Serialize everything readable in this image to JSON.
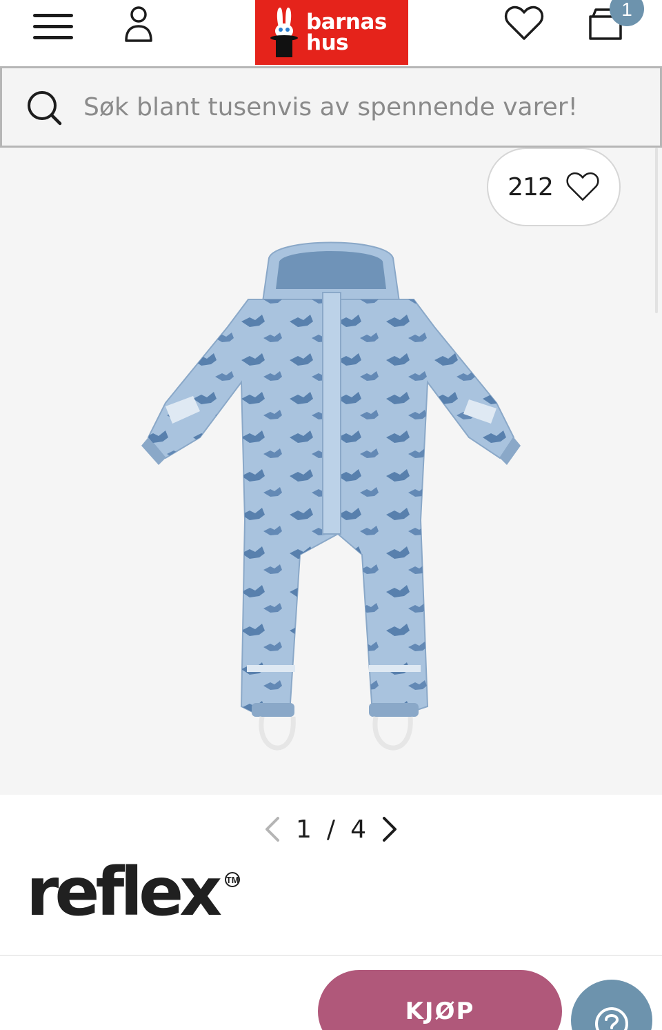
{
  "header": {
    "logo_line1": "barnas",
    "logo_line2": "hus",
    "cart_count": "1",
    "icons": [
      "menu-icon",
      "user-icon",
      "heart-icon",
      "cart-icon"
    ]
  },
  "search": {
    "placeholder": "Søk blant tusenvis av spennende varer!"
  },
  "product": {
    "favorite_count": "212",
    "image_pager": {
      "current": "1",
      "separator": "/",
      "total": "4"
    },
    "brand": "reflex",
    "brand_mark": "TM"
  },
  "actions": {
    "buy_label": "KJØP",
    "help_icon": "question-icon"
  },
  "colors": {
    "logo_red": "#e5231b",
    "buy_button": "#b0587a",
    "badge_blue": "#6d93ad",
    "search_bg": "#f4f4f4",
    "gallery_bg": "#f5f5f5"
  }
}
